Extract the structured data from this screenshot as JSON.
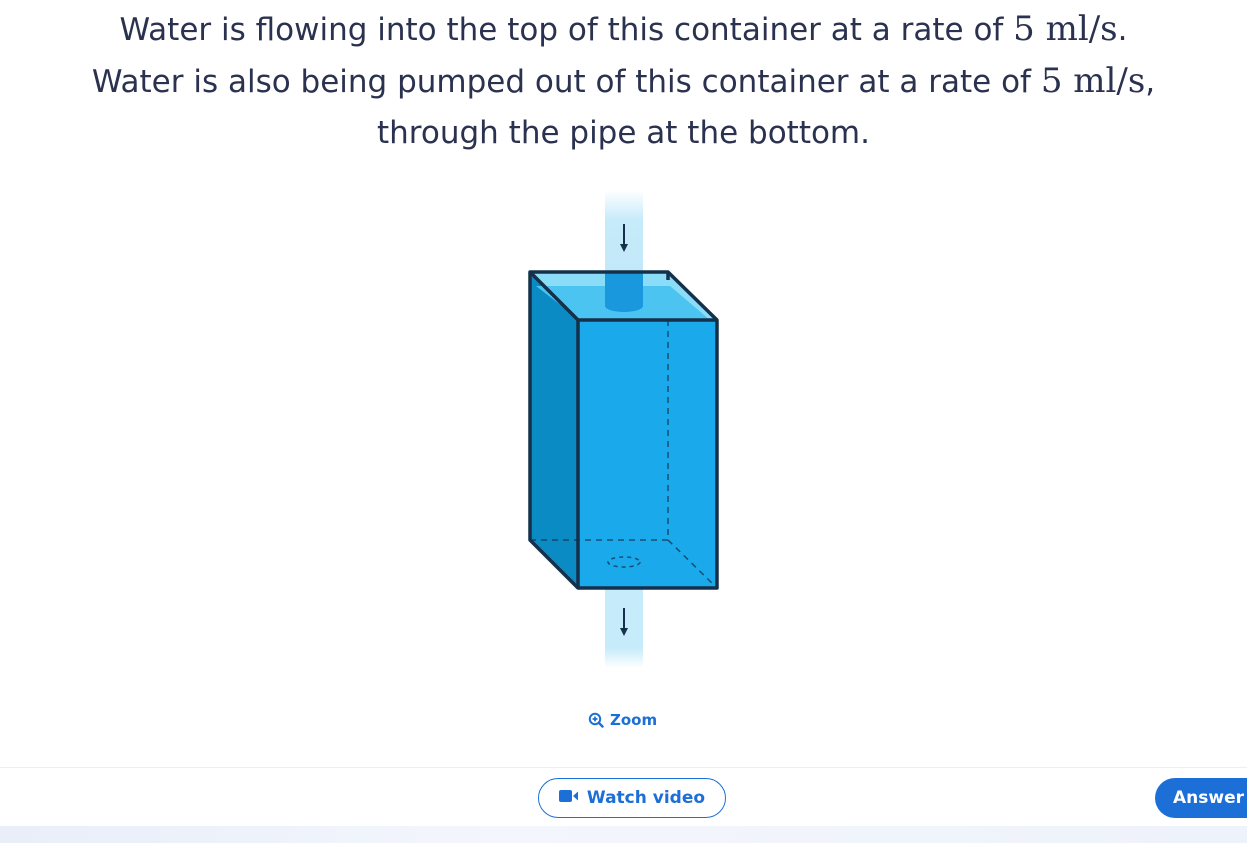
{
  "question": {
    "line1_text": "Water is flowing into the top of this container at a rate of ",
    "line1_math": "5 ml/s",
    "line1_end": ".",
    "line2_text": "Water is also being pumped out of this container at a rate of ",
    "line2_math": "5 ml/s",
    "line2_end": ",",
    "line3_text": "through the pipe at the bottom."
  },
  "zoom": {
    "label": "Zoom",
    "icon": "zoom-in-icon"
  },
  "footer": {
    "watch_video_label": "Watch video",
    "watch_video_icon": "video-camera-icon",
    "answer_label": "Answer"
  },
  "colors": {
    "accent": "#1b6fd6",
    "water_front": "#1aa9ea",
    "water_side": "#0a8bc4",
    "water_top": "#6fd3f5",
    "pipe": "#c6ebfa",
    "outline": "#14304a"
  }
}
